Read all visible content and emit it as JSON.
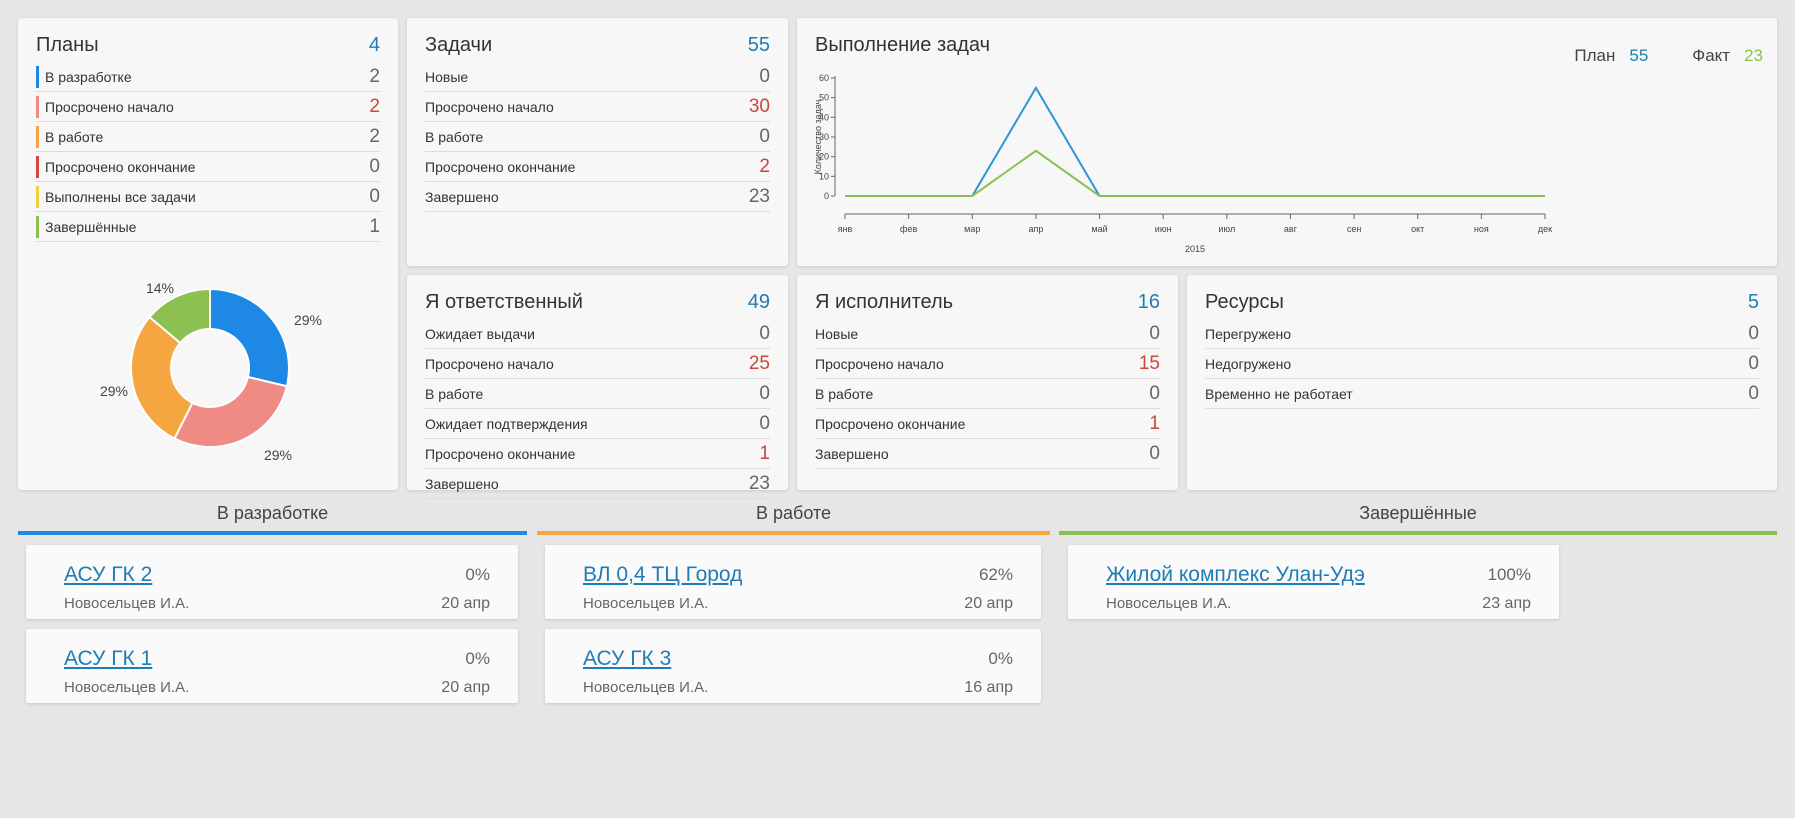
{
  "colors": {
    "blue": "#1e7db4",
    "red": "#c9473b",
    "plan_line": "#2b97d9",
    "fact_line": "#8cc152",
    "dev": "#1e88e5",
    "overdue_start": "#f08a84",
    "in_work": "#f5a640",
    "overdue_end": "#d64541",
    "all_done": "#f3d33a",
    "done": "#8cc152"
  },
  "plans": {
    "title": "Планы",
    "count": "4",
    "rows": [
      {
        "label": "В разработке",
        "value": "2",
        "color": "#1e88e5",
        "red": false
      },
      {
        "label": "Просрочено начало",
        "value": "2",
        "color": "#f08a84",
        "red": true
      },
      {
        "label": "В работе",
        "value": "2",
        "color": "#f5a640",
        "red": false
      },
      {
        "label": "Просрочено окончание",
        "value": "0",
        "color": "#d64541",
        "red": false
      },
      {
        "label": "Выполнены все задачи",
        "value": "0",
        "color": "#f3d33a",
        "red": false
      },
      {
        "label": "Завершённые",
        "value": "1",
        "color": "#8cc152",
        "red": false
      }
    ],
    "donut": [
      {
        "label": "29%",
        "value": 29,
        "color": "#1e88e5"
      },
      {
        "label": "29%",
        "value": 29,
        "color": "#f08a84"
      },
      {
        "label": "29%",
        "value": 29,
        "color": "#f5a640"
      },
      {
        "label": "14%",
        "value": 14,
        "color": "#8cc152"
      }
    ]
  },
  "tasks": {
    "title": "Задачи",
    "count": "55",
    "rows": [
      {
        "label": "Новые",
        "value": "0",
        "red": false
      },
      {
        "label": "Просрочено начало",
        "value": "30",
        "red": true
      },
      {
        "label": "В работе",
        "value": "0",
        "red": false
      },
      {
        "label": "Просрочено окончание",
        "value": "2",
        "red": true
      },
      {
        "label": "Завершено",
        "value": "23",
        "red": false
      }
    ]
  },
  "execution": {
    "title": "Выполнение задач",
    "plan_label": "План",
    "plan_value": "55",
    "fact_label": "Факт",
    "fact_value": "23"
  },
  "chart_data": {
    "type": "line",
    "title": "Выполнение задач",
    "xlabel": "2015",
    "ylabel": "Количество задач",
    "categories": [
      "янв",
      "фев",
      "мар",
      "апр",
      "май",
      "июн",
      "июл",
      "авг",
      "сен",
      "окт",
      "ноя",
      "дек"
    ],
    "series": [
      {
        "name": "План",
        "values": [
          0,
          0,
          0,
          55,
          0,
          0,
          0,
          0,
          0,
          0,
          0,
          0
        ],
        "color": "#2b97d9"
      },
      {
        "name": "Факт",
        "values": [
          0,
          0,
          0,
          23,
          0,
          0,
          0,
          0,
          0,
          0,
          0,
          0
        ],
        "color": "#8cc152"
      }
    ],
    "yticks": [
      0,
      10,
      20,
      30,
      40,
      50,
      60
    ],
    "ylim": [
      0,
      60
    ],
    "grid": false
  },
  "responsible": {
    "title": "Я ответственный",
    "count": "49",
    "rows": [
      {
        "label": "Ожидает выдачи",
        "value": "0",
        "red": false
      },
      {
        "label": "Просрочено начало",
        "value": "25",
        "red": true
      },
      {
        "label": "В работе",
        "value": "0",
        "red": false
      },
      {
        "label": "Ожидает подтверждения",
        "value": "0",
        "red": false
      },
      {
        "label": "Просрочено окончание",
        "value": "1",
        "red": true
      },
      {
        "label": "Завершено",
        "value": "23",
        "red": false
      }
    ]
  },
  "executor": {
    "title": "Я исполнитель",
    "count": "16",
    "rows": [
      {
        "label": "Новые",
        "value": "0",
        "red": false
      },
      {
        "label": "Просрочено начало",
        "value": "15",
        "red": true
      },
      {
        "label": "В работе",
        "value": "0",
        "red": false
      },
      {
        "label": "Просрочено окончание",
        "value": "1",
        "red": true
      },
      {
        "label": "Завершено",
        "value": "0",
        "red": false
      }
    ]
  },
  "resources": {
    "title": "Ресурсы",
    "count": "5",
    "rows": [
      {
        "label": "Перегружено",
        "value": "0",
        "red": false
      },
      {
        "label": "Недогружено",
        "value": "0",
        "red": false
      },
      {
        "label": "Временно не работает",
        "value": "0",
        "red": false
      }
    ]
  },
  "kanban": {
    "columns": [
      {
        "title": "В разработке",
        "color": "#1e88e5",
        "cards": [
          {
            "name": "АСУ ГК 2",
            "percent": "0%",
            "owner": "Новосельцев И.А.",
            "date": "20 апр"
          },
          {
            "name": "АСУ ГК 1",
            "percent": "0%",
            "owner": "Новосельцев И.А.",
            "date": "20 апр"
          }
        ]
      },
      {
        "title": "В работе",
        "color": "#f5a640",
        "cards": [
          {
            "name": "ВЛ 0,4 ТЦ Город",
            "percent": "62%",
            "owner": "Новосельцев И.А.",
            "date": "20 апр"
          },
          {
            "name": "АСУ ГК 3",
            "percent": "0%",
            "owner": "Новосельцев И.А.",
            "date": "16 апр"
          }
        ]
      },
      {
        "title": "Завершённые",
        "color": "#8cc152",
        "cards": [
          {
            "name": "Жилой комплекс Улан-Удэ",
            "percent": "100%",
            "owner": "Новосельцев И.А.",
            "date": "23 апр"
          }
        ]
      }
    ]
  }
}
